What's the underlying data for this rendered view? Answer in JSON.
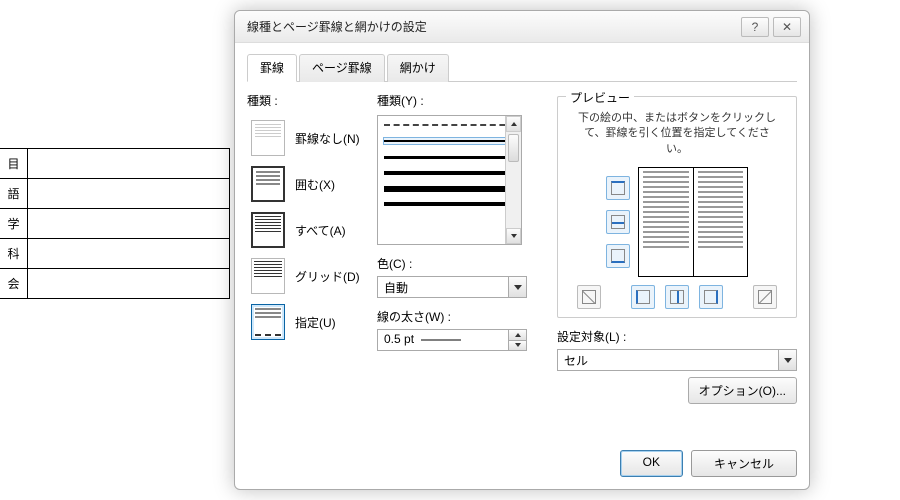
{
  "bg_rows": [
    "目",
    "語",
    "学",
    "科",
    "会"
  ],
  "dialog": {
    "title": "線種とページ罫線と網かけの設定",
    "tabs": [
      "罫線",
      "ページ罫線",
      "網かけ"
    ],
    "active_tab": 0,
    "col1": {
      "heading": "種類 :",
      "presets": [
        {
          "label": "罫線なし(N)"
        },
        {
          "label": "囲む(X)"
        },
        {
          "label": "すべて(A)"
        },
        {
          "label": "グリッド(D)"
        },
        {
          "label": "指定(U)"
        }
      ],
      "selected_preset": 4
    },
    "col2": {
      "style_label": "種類(Y) :",
      "color_label": "色(C) :",
      "color_value": "自動",
      "width_label": "線の太さ(W) :",
      "width_value": "0.5 pt"
    },
    "col3": {
      "group_title": "プレビュー",
      "hint": "下の絵の中、またはボタンをクリックして、罫線を引く位置を指定してください。",
      "apply_label": "設定対象(L) :",
      "apply_value": "セル",
      "options_button": "オプション(O)..."
    },
    "buttons": {
      "ok": "OK",
      "cancel": "キャンセル"
    }
  }
}
